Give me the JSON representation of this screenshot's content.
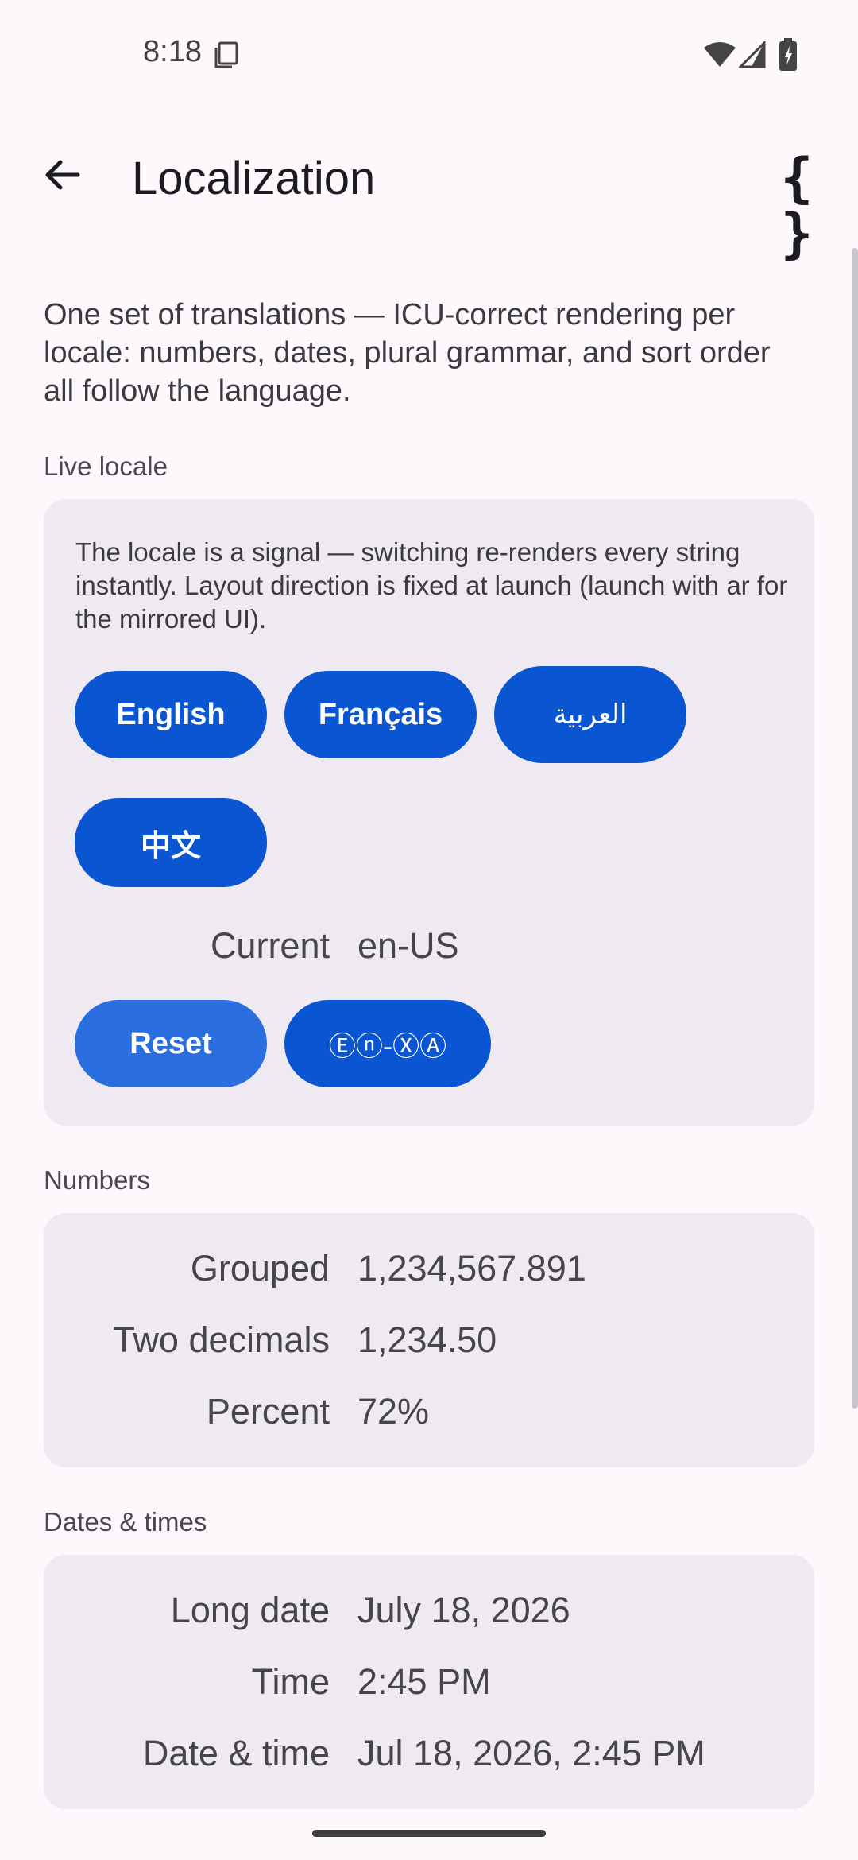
{
  "status_bar": {
    "time": "8:18"
  },
  "app_bar": {
    "title": "Localization"
  },
  "intro": "One set of translations — ICU-correct rendering per locale: numbers, dates, plural grammar, and sort order all follow the language.",
  "live_locale": {
    "label": "Live locale",
    "note": "The locale is a signal — switching re-renders every string instantly. Layout direction is fixed at launch (launch with ar for the mirrored UI).",
    "buttons": {
      "english": "English",
      "french": "Français",
      "arabic": "العربية",
      "chinese": "中文"
    },
    "current_label": "Current",
    "current_value": "en-US",
    "reset_label": "Reset",
    "pseudo_label": "Ⓔⓝ-ⓍⒶ"
  },
  "numbers": {
    "label": "Numbers",
    "rows": [
      {
        "label": "Grouped",
        "value": "1,234,567.891"
      },
      {
        "label": "Two decimals",
        "value": "1,234.50"
      },
      {
        "label": "Percent",
        "value": "72%"
      }
    ]
  },
  "dates": {
    "label": "Dates & times",
    "rows": [
      {
        "label": "Long date",
        "value": "July 18, 2026"
      },
      {
        "label": "Time",
        "value": "2:45 PM"
      },
      {
        "label": "Date & time",
        "value": "Jul 18, 2026, 2:45 PM"
      }
    ]
  },
  "colors": {
    "accent": "#0a55d1",
    "accent_light": "#2b6ee0",
    "card": "#efeaf2",
    "background": "#fdf8fc"
  },
  "icons": [
    "sim-icon",
    "wifi-icon",
    "signal-icon",
    "battery-icon",
    "back-arrow-icon",
    "braces-icon"
  ]
}
